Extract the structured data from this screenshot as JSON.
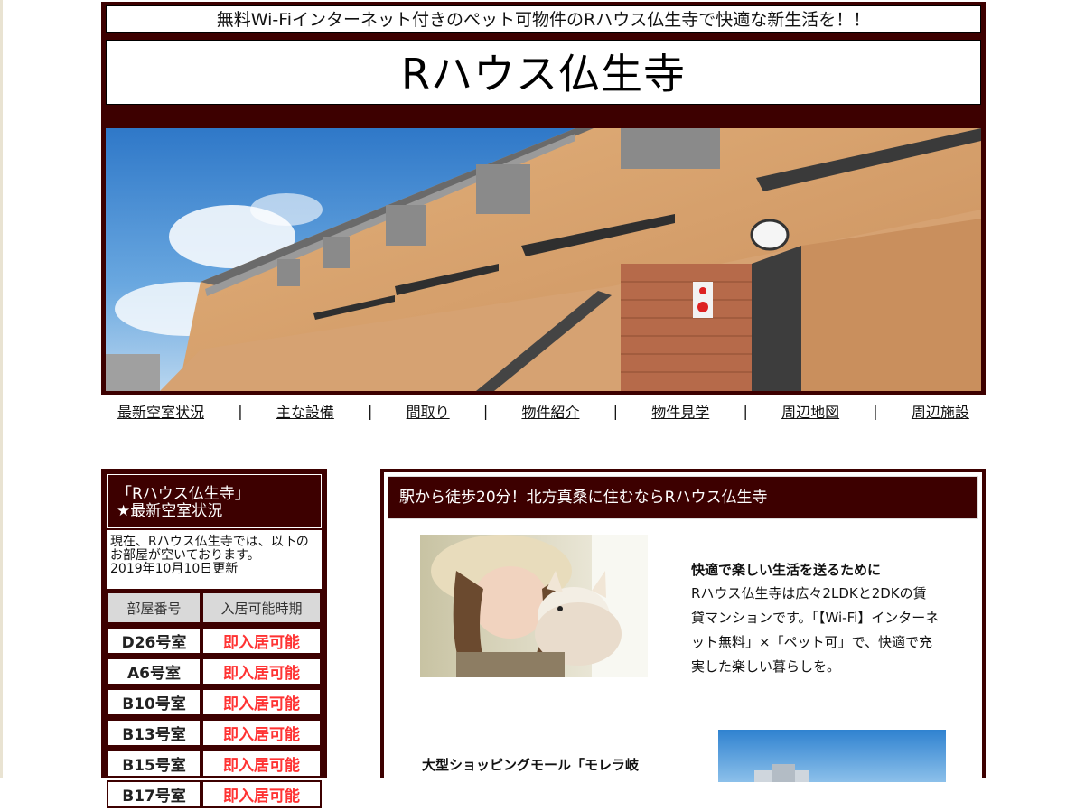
{
  "header": {
    "tagline": "無料Wi-Fiインターネット付きのペット可物件のRハウス仏生寺で快適な新生活を！！",
    "site_title": "Rハウス仏生寺"
  },
  "nav": {
    "items": [
      "最新空室状況",
      "主な設備",
      "間取り",
      "物件紹介",
      "物件見学",
      "周辺地図",
      "周辺施設"
    ],
    "separator": "|"
  },
  "sidebar": {
    "heading_line1": "「Rハウス仏生寺」",
    "heading_line2": "★最新空室状況",
    "description": "現在、Rハウス仏生寺では、以下のお部屋が空いております。",
    "updated": "2019年10月10日更新",
    "table_headers": [
      "部屋番号",
      "入居可能時期"
    ],
    "rows": [
      {
        "room": "D26号室",
        "status": "即入居可能"
      },
      {
        "room": "A6号室",
        "status": "即入居可能"
      },
      {
        "room": "B10号室",
        "status": "即入居可能"
      },
      {
        "room": "B13号室",
        "status": "即入居可能"
      },
      {
        "room": "B15号室",
        "status": "即入居可能"
      },
      {
        "room": "B17号室",
        "status": "即入居可能"
      }
    ]
  },
  "main": {
    "heading": "駅から徒歩20分！北方真桑に住むならRハウス仏生寺",
    "intro_title": "快適で楽しい生活を送るために",
    "intro_text": "Rハウス仏生寺は広々2LDKと2DKの賃貸マンションです。「【Wi-Fi】インターネット無料」×「ペット可」で、快適で充実した楽しい暮らしを。",
    "shop_title": "大型ショッピングモール「モレラ岐"
  },
  "colors": {
    "frame": "#3d0000",
    "status_available": "#ff3333"
  }
}
